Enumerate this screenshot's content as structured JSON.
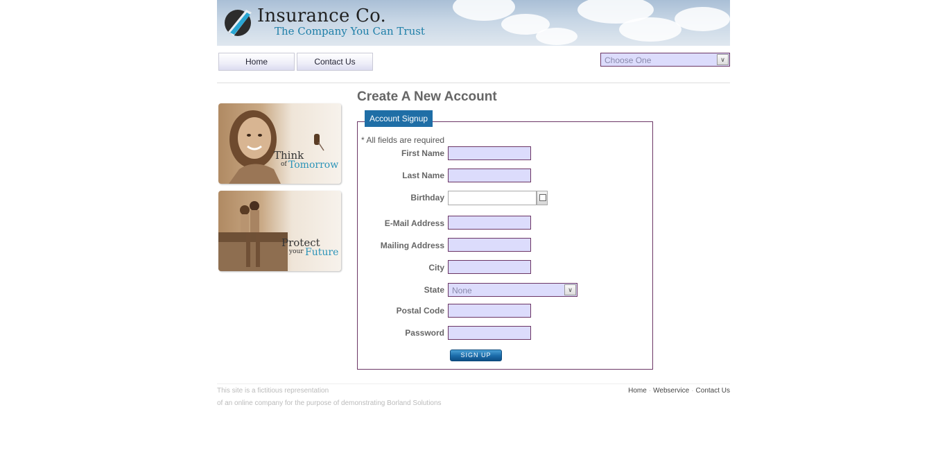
{
  "brand": {
    "name": "Insurance Co.",
    "tagline": "The Company You Can Trust"
  },
  "nav": {
    "home": "Home",
    "contact": "Contact Us",
    "selector": {
      "selected": "Choose One"
    }
  },
  "promos": [
    {
      "line1": "Think",
      "line2": "of",
      "line3": "Tomorrow"
    },
    {
      "line1": "Protect",
      "line2": "your",
      "line3": "Future"
    }
  ],
  "form": {
    "page_title": "Create A New Account",
    "legend": "Account Signup",
    "required_note": "* All fields are required",
    "labels": {
      "first_name": "First Name",
      "last_name": "Last Name",
      "birthday": "Birthday",
      "email": "E-Mail Address",
      "mailing_address": "Mailing Address",
      "city": "City",
      "state": "State",
      "postal_code": "Postal Code",
      "password": "Password"
    },
    "values": {
      "first_name": "",
      "last_name": "",
      "birthday": "",
      "email": "",
      "mailing_address": "",
      "city": "",
      "postal_code": "",
      "password": ""
    },
    "state_selected": "None",
    "submit": "SIGN UP"
  },
  "footer": {
    "disclaimer_line1": "This site is a fictitious representation",
    "disclaimer_line2": "of an online company for the purpose of demonstrating Borland Solutions",
    "links": [
      "Home",
      "Webservice",
      "Contact Us"
    ]
  },
  "colors": {
    "accent": "#1f6ea6",
    "field_bg": "#dcdcfc",
    "field_border": "#6b3565",
    "tagline": "#1e7fa8"
  }
}
